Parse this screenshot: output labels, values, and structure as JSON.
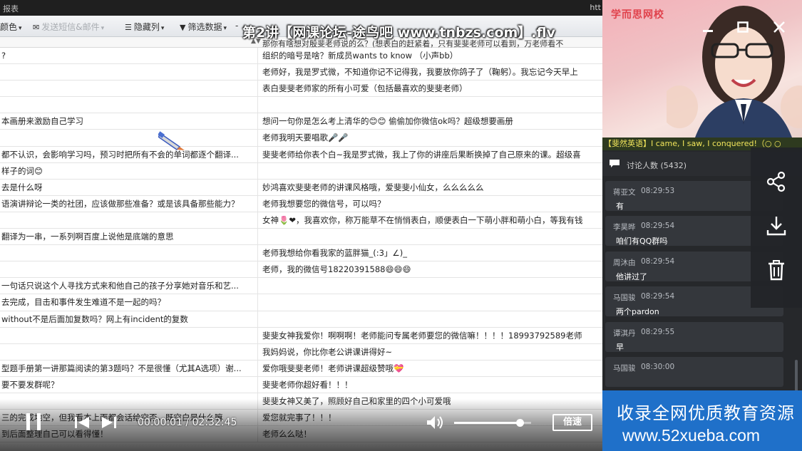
{
  "titlebar": {
    "title": "报表",
    "url_fragment": "htt"
  },
  "watermark": "第2讲【网课论坛-途鸟吧 www.tnbzs.com】.flv",
  "toolbar": {
    "color": "颜色",
    "send_sms": "发送短信&邮件",
    "hide_columns": "隐藏列",
    "filter_data": "筛选数据",
    "next_item": "-"
  },
  "filter_row_text": "那你有啥想对殷斐老师说的么？(想表白的赶紧着，只有斐斐老师可以看到，万老师看不",
  "grid_rows": [
    {
      "a": "?",
      "b": "组织的暗号是啥？新成员wants to know （小声bb）"
    },
    {
      "a": "",
      "b": "老师好，我是罗式微，不知道你记不记得我，我要放你鸽子了（鞠躬）。我忘记今天早上"
    },
    {
      "a": "",
      "b": "表白斐斐老师家的所有小可爱（包括最喜欢的斐斐老师）"
    },
    {
      "a": "",
      "b": ""
    },
    {
      "a": "本画册来激励自己学习",
      "b": "想问一句你是怎么考上清华的😊😊 偷偷加你微信ok吗？超级想要画册"
    },
    {
      "a": "",
      "b": "老师我明天要唱歌🎤🎤"
    },
    {
      "a": "都不认识，会影响学习吗，预习时把所有不会的单词都逐个翻译...",
      "b": "斐斐老师给你表个白~我是罗式微，我上了你的讲座后果断换掉了自己原来的课。超级喜"
    },
    {
      "a": "样子的词😊",
      "b": ""
    },
    {
      "a": "去是什么呀",
      "b": "妙鸿喜欢斐斐老师的讲课风格哦，爱斐斐小仙女，么么么么么"
    },
    {
      "a": "语演讲辩论一类的社团，应该做那些准备？或是该具备那些能力？",
      "b": "老师我想要您的微信号，可以吗？"
    },
    {
      "a": "",
      "b": "女神🌷❤，我喜欢你，称万能草不在悄悄表白，顺便表白一下萌小胖和萌小白，等我有钱"
    },
    {
      "a": "翻译为一串，一系列啊百度上说他是底端的意思",
      "b": ""
    },
    {
      "a": "",
      "b": "老师我想给你看我家的蓝胖猫_(:3」∠)_"
    },
    {
      "a": "",
      "b": "老师，我的微信号18220391588😄😄😄"
    },
    {
      "a": "一句话只说这个人寻找方式来和他自己的孩子分享她对音乐和艺...",
      "b": ""
    },
    {
      "a": "去完成，目击和事件发生难道不是一起的吗？",
      "b": ""
    },
    {
      "a": "without不是后面加复数吗？网上有incident的复数",
      "b": ""
    },
    {
      "a": "",
      "b": "斐斐女神我爱你！啊啊啊！老师能问专属老师要您的微信嘛！！！！18993792589老师"
    },
    {
      "a": "",
      "b": "我妈妈说，你比你老公讲课讲得好~"
    },
    {
      "a": "型题手册第一讲那篇阅读的第3题吗？不是很懂（尤其A选项）谢...",
      "b": "爱你哦斐斐老师！老师讲课超级赞哦💝"
    },
    {
      "a": "要不要发群呢？",
      "b": "斐斐老师你超好看！！！"
    },
    {
      "a": "",
      "b": "斐斐女神又美了，照顾好自己和家里的四个小可爱哦"
    },
    {
      "a": "三的完成地空，但我看本上面都会话给空否，既空白是什么嘛",
      "b": "爱您就完事了！！！"
    },
    {
      "a": "到后面整理自己可以看得懂！",
      "b": "老师么么哒！"
    }
  ],
  "player": {
    "current_time": "00:00:01",
    "total_time": "02:32:45",
    "time_separator": " / ",
    "speed_label": "倍速",
    "volume_level": 0.85
  },
  "camera": {
    "brand": "学而思网校",
    "marquee": "【斐然英语】I came, I saw, I conquered!（○ ○"
  },
  "chat": {
    "header_label": "讨论人数",
    "count": "(5432)",
    "messages": [
      {
        "name": "蒋亚文",
        "time": "08:29:53",
        "text": "有"
      },
      {
        "name": "李昊晔",
        "time": "08:29:54",
        "text": "咱们有QQ群吗"
      },
      {
        "name": "周沐由",
        "time": "08:29:54",
        "text": "他讲过了"
      },
      {
        "name": "马国骏",
        "time": "08:29:54",
        "text": "两个pardon"
      },
      {
        "name": "谭淇丹",
        "time": "08:29:55",
        "text": "早"
      },
      {
        "name": "马国骏",
        "time": "08:30:00",
        "text": ""
      }
    ]
  },
  "side_actions": {
    "share": "share-icon",
    "download": "download-icon",
    "delete": "trash-icon"
  },
  "ad": {
    "line1": "收录全网优质教育资源",
    "line2": "www.52xueba.com"
  },
  "colors": {
    "ad_bg": "#1f70c9",
    "marquee_text": "#f2e65b",
    "brand_red": "#e0424c"
  }
}
